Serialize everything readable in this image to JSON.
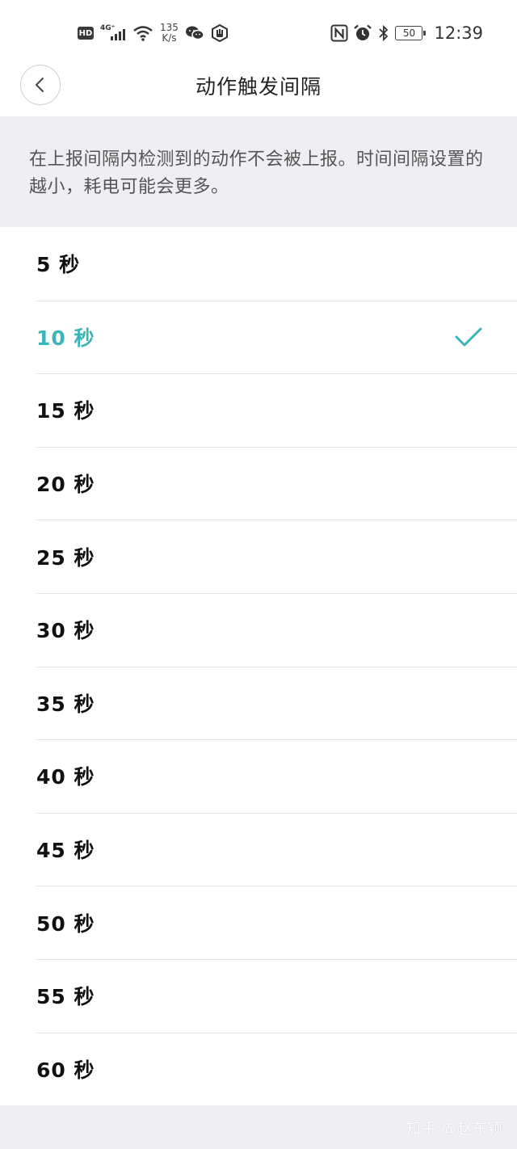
{
  "status_bar": {
    "hd": "HD",
    "network": "4G⁺",
    "speed_value": "135",
    "speed_unit": "K/s",
    "battery": "50",
    "time": "12:39",
    "icons": [
      "hd-icon",
      "signal-icon",
      "wifi-icon",
      "wechat-icon",
      "hand-icon",
      "nfc-icon",
      "alarm-icon",
      "bluetooth-icon",
      "battery-icon"
    ]
  },
  "nav": {
    "title": "动作触发间隔"
  },
  "description": "在上报间隔内检测到的动作不会被上报。时间间隔设置的越小，耗电可能会更多。",
  "options": [
    {
      "label": "5 秒",
      "selected": false
    },
    {
      "label": "10 秒",
      "selected": true
    },
    {
      "label": "15 秒",
      "selected": false
    },
    {
      "label": "20 秒",
      "selected": false
    },
    {
      "label": "25 秒",
      "selected": false
    },
    {
      "label": "30 秒",
      "selected": false
    },
    {
      "label": "35 秒",
      "selected": false
    },
    {
      "label": "40 秒",
      "selected": false
    },
    {
      "label": "45 秒",
      "selected": false
    },
    {
      "label": "50 秒",
      "selected": false
    },
    {
      "label": "55 秒",
      "selected": false
    },
    {
      "label": "60 秒",
      "selected": false
    }
  ],
  "colors": {
    "accent": "#3bb5b8",
    "background_gray": "#efeff3",
    "text_primary": "#111111",
    "text_secondary": "#555555"
  },
  "watermark": "知乎 @赵东颖"
}
